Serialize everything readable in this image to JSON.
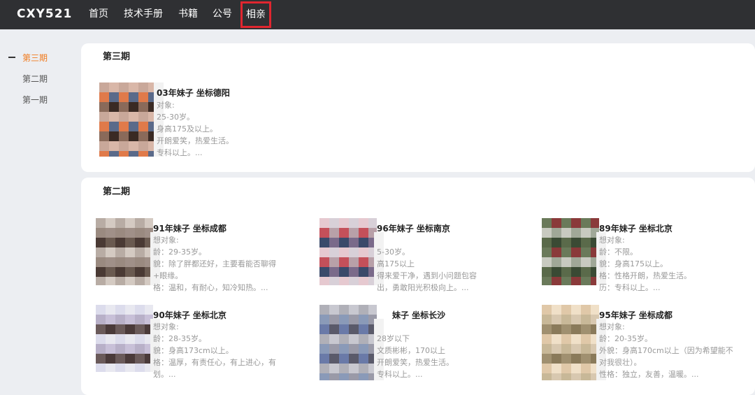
{
  "header": {
    "brand": "CXY521",
    "nav": [
      {
        "label": "首页"
      },
      {
        "label": "技术手册"
      },
      {
        "label": "书籍"
      },
      {
        "label": "公号"
      },
      {
        "label": "相亲"
      }
    ]
  },
  "sidebar": {
    "items": [
      {
        "label": "第三期"
      },
      {
        "label": "第二期"
      },
      {
        "label": "第一期"
      }
    ]
  },
  "sections": [
    {
      "title": "第三期",
      "entries": [
        {
          "title": "03年妹子 坐标德阳",
          "lines": [
            "对象:",
            "25-30岁。",
            "身高175及以上。",
            "开朗爱笑，热爱生活。",
            "专科以上。..."
          ]
        }
      ]
    },
    {
      "title": "第二期",
      "entries": [
        {
          "title": "91年妹子 坐标成都",
          "lines": [
            "想对象:",
            "龄：29-35岁。",
            "貌：除了胖都还好，主要看能否聊得",
            "+眼缘。",
            "格：温和，有耐心，知冷知热。..."
          ]
        },
        {
          "title": "96年妹子 坐标南京",
          "lines": [
            "",
            "5-30岁。",
            "高175以上",
            "得来爱干净，遇到小问题包容",
            "出，勇敢阳光积极向上。..."
          ]
        },
        {
          "title": "89年妹子 坐标北京",
          "lines": [
            "想对象:",
            "龄：不限。",
            "貌：身高175以上。",
            "格：性格开朗，热爱生活。",
            "历：专科以上。..."
          ]
        },
        {
          "title": "90年妹子 坐标北京",
          "lines": [
            "想对象:",
            "龄：28-35岁。",
            "貌：身高173cm以上。",
            "格：温厚，有责任心，有上进心，有",
            "划。..."
          ]
        },
        {
          "title": "妹子 坐标长沙",
          "lines": [
            "",
            "28岁以下",
            "文质彬彬，170以上",
            "开朗爱笑，热爱生活。",
            "专科以上。..."
          ]
        },
        {
          "title": "95年妹子 坐标成都",
          "lines": [
            "想对象:",
            "龄：20-35岁。",
            "外貌：身高170cm以上（因为希望能不",
            "对我很壮）。",
            "性格：独立，友善，温暖。..."
          ]
        }
      ]
    }
  ],
  "thumb_colors": [
    [
      "#c9a89a",
      "#3a2a24",
      "#e07a4a",
      "#d9b7a8",
      "#8a6a5a",
      "#5a6a8a"
    ],
    [
      "#b8aca4",
      "#6a5a50",
      "#9a8a80",
      "#d4cac2",
      "#4a3a34",
      "#a09088"
    ],
    [
      "#e6c9d0",
      "#7a6a8a",
      "#c4505a",
      "#d8d0d8",
      "#3a4a6a",
      "#b8a0a8"
    ],
    [
      "#6a7a5a",
      "#3a4a34",
      "#c8cac0",
      "#8a3a3a",
      "#5a6a4a",
      "#a0a898"
    ],
    [
      "#dcdcec",
      "#4a3a3a",
      "#b8b0c8",
      "#e8e8f0",
      "#6a5a5a",
      "#c8c0d8"
    ],
    [
      "#b0b0b8",
      "#5a5a6a",
      "#8a9ab8",
      "#c8c8d0",
      "#6a7aa8",
      "#9a9aa8"
    ],
    [
      "#e0c8a8",
      "#8a7a5a",
      "#c8b898",
      "#f0e0c8",
      "#a09070",
      "#d8c8b0"
    ]
  ]
}
